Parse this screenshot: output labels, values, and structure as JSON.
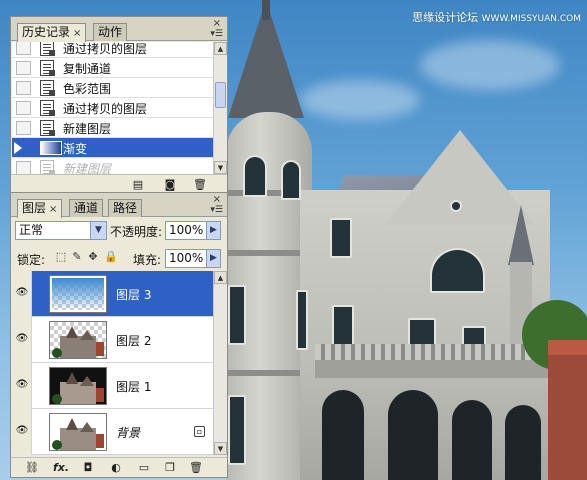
{
  "watermark": {
    "site": "思缘设计论坛",
    "url": "WWW.MISSYUAN.COM"
  },
  "history_panel": {
    "tabs": [
      {
        "label": "历史记录",
        "close": "×"
      },
      {
        "label": "动作"
      }
    ],
    "items": [
      {
        "label": "通过拷贝的图层"
      },
      {
        "label": "复制通道"
      },
      {
        "label": "色彩范围"
      },
      {
        "label": "通过拷贝的图层"
      },
      {
        "label": "新建图层"
      },
      {
        "label": "渐变",
        "selected": true
      },
      {
        "label": "新建图层",
        "dimmed": true
      }
    ],
    "footer_icons": [
      "new-document-from-state-icon",
      "camera-snapshot-icon",
      "trash-icon"
    ]
  },
  "layers_panel": {
    "tabs": [
      {
        "label": "图层",
        "close": "×"
      },
      {
        "label": "通道"
      },
      {
        "label": "路径"
      }
    ],
    "blend_mode": "正常",
    "opacity_label": "不透明度:",
    "opacity_value": "100%",
    "lock_label": "锁定:",
    "fill_label": "填充:",
    "fill_value": "100%",
    "layers": [
      {
        "name": "图层 3",
        "selected": true,
        "visible": true
      },
      {
        "name": "图层 2",
        "visible": true
      },
      {
        "name": "图层 1",
        "visible": true
      },
      {
        "name": "背景",
        "visible": true,
        "locked": true
      }
    ],
    "footer_icons": [
      "link-layers-icon",
      "layer-style-fx-icon",
      "add-mask-icon",
      "adjustment-layer-icon",
      "new-group-icon",
      "new-layer-icon",
      "trash-icon"
    ],
    "fx_label": "fx."
  }
}
